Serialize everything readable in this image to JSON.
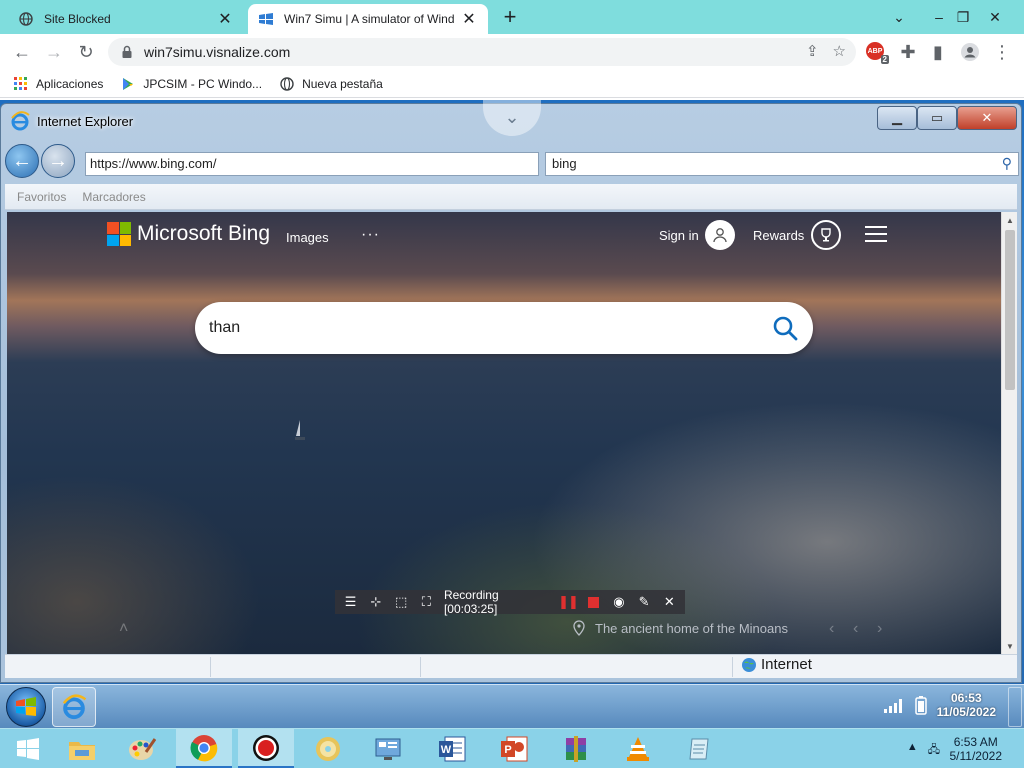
{
  "chrome": {
    "tabs": [
      {
        "title": "Site Blocked",
        "active": false
      },
      {
        "title": "Win7 Simu | A simulator of Wind",
        "active": true
      }
    ],
    "url": "win7simu.visnalize.com",
    "extension_badge": "2",
    "extension_label": "ABP",
    "bookmarks": [
      "Aplicaciones",
      "JPCSIM - PC Windo...",
      "Nueva pestaña"
    ]
  },
  "ie": {
    "title": "Internet Explorer",
    "address": "https://www.bing.com/",
    "search": "bing",
    "favbar": [
      "Favoritos",
      "Marcadores"
    ],
    "status_zone": "Internet"
  },
  "bing": {
    "brand": "Microsoft Bing",
    "images": "Images",
    "more": "···",
    "signin": "Sign in",
    "rewards": "Rewards",
    "query": "than",
    "caption": "The ancient home of the Minoans"
  },
  "recorder": {
    "status": "Recording [00:03:25]"
  },
  "win7": {
    "time": "06:53",
    "date": "11/05/2022"
  },
  "host": {
    "time": "6:53 AM",
    "date": "5/11/2022"
  },
  "colors": {
    "tabstrip": "#7fdddd",
    "host_taskbar": "#8ad2e8",
    "bing_accent": "#0f6cbd",
    "record_red": "#e03030"
  }
}
